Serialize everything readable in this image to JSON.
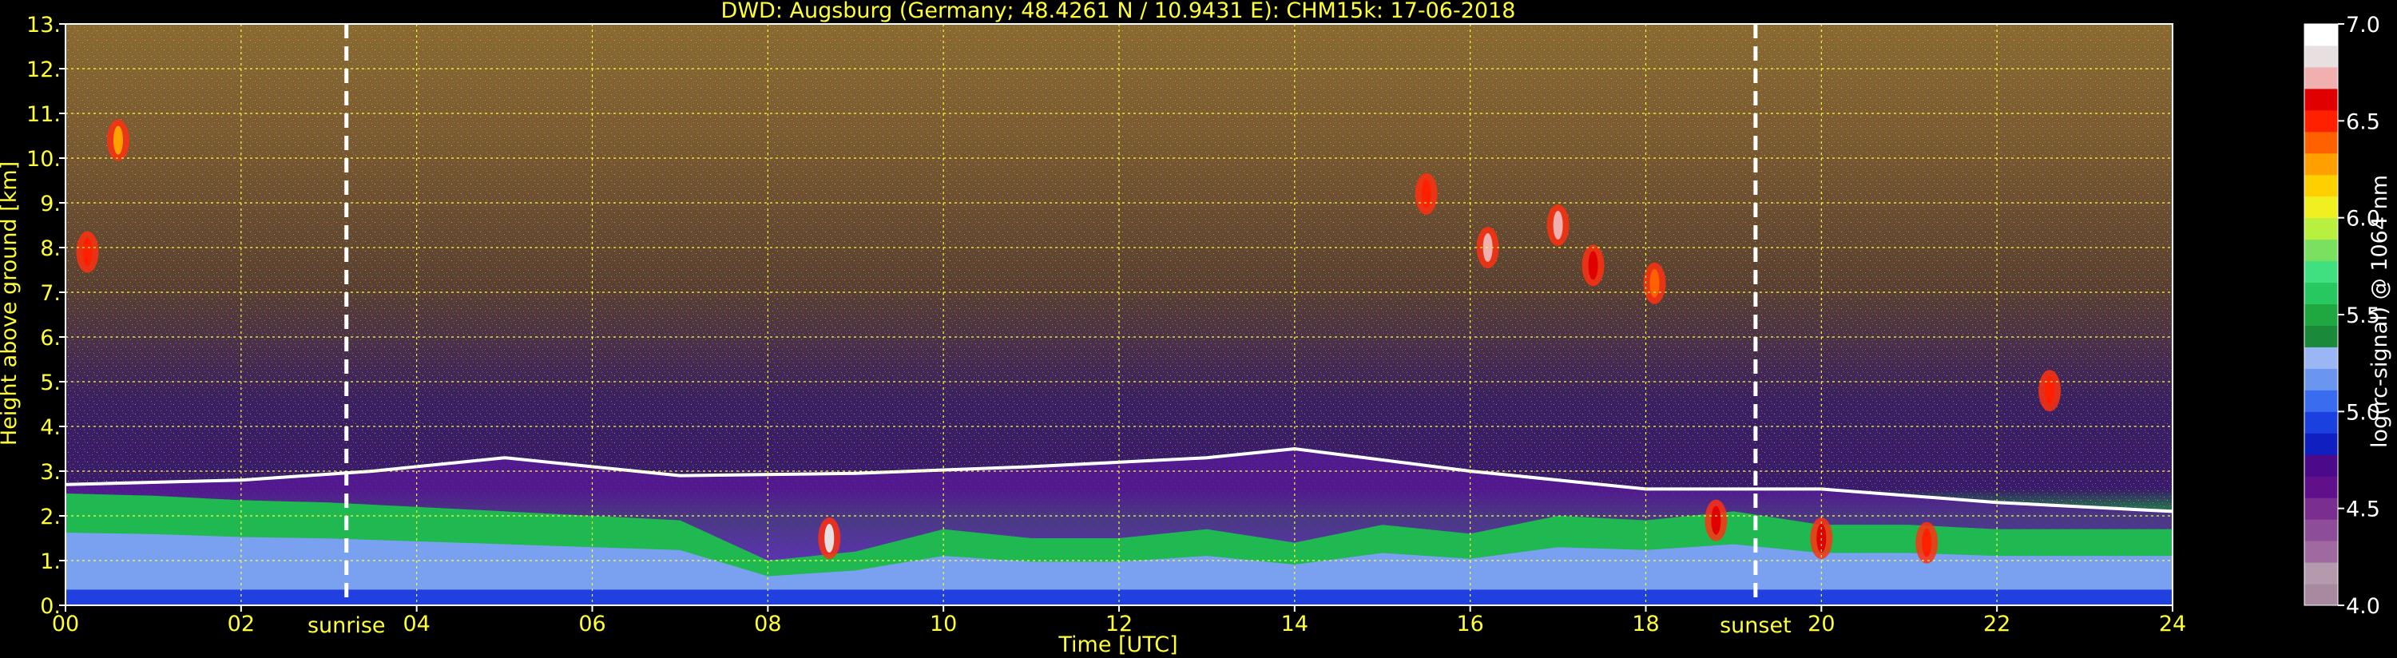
{
  "chart_data": {
    "type": "heatmap",
    "title": "DWD: Augsburg (Germany; 48.4261 N / 10.9431 E):    CHM15k: 17-06-2018",
    "xlabel": "Time [UTC]",
    "ylabel": "Height above ground [km]",
    "xlim": [
      0,
      24
    ],
    "ylim": [
      0,
      13
    ],
    "x_ticks": [
      "00",
      "02",
      "04",
      "06",
      "08",
      "10",
      "12",
      "14",
      "16",
      "18",
      "20",
      "22",
      "24"
    ],
    "y_ticks": [
      "0.",
      "1.",
      "2.",
      "3.",
      "4.",
      "5.",
      "6.",
      "7.",
      "8.",
      "9.",
      "10.",
      "11.",
      "12.",
      "13."
    ],
    "grid": true,
    "events": [
      {
        "label": "sunrise",
        "time": 3.2
      },
      {
        "label": "sunset",
        "time": 19.25
      }
    ],
    "colorbar": {
      "label": "log(rc-signal) @ 1064 nm",
      "range": [
        4.0,
        7.0
      ],
      "ticks": [
        "4.0",
        "4.5",
        "5.0",
        "5.5",
        "6.0",
        "6.5",
        "7.0"
      ],
      "colors": [
        "#a88aa0",
        "#b59aad",
        "#9e6aa0",
        "#8e4d98",
        "#7a2e90",
        "#60108a",
        "#4a0a8a",
        "#1020c0",
        "#1a40e0",
        "#3a6cf0",
        "#6a96f0",
        "#9ab6f5",
        "#1a8a3a",
        "#20a840",
        "#28c860",
        "#40e080",
        "#7ae060",
        "#b8f040",
        "#f0f020",
        "#ffd000",
        "#ffa000",
        "#ff6000",
        "#ff2000",
        "#e00000",
        "#f0b0b0",
        "#e8e0e0",
        "#ffffff"
      ]
    },
    "boundary_layer_top_km": [
      {
        "time": 0,
        "height": 2.5
      },
      {
        "time": 1,
        "height": 2.45
      },
      {
        "time": 2,
        "height": 2.35
      },
      {
        "time": 3,
        "height": 2.3
      },
      {
        "time": 4,
        "height": 2.2
      },
      {
        "time": 5,
        "height": 2.1
      },
      {
        "time": 6,
        "height": 2.0
      },
      {
        "time": 7,
        "height": 1.9
      },
      {
        "time": 8,
        "height": 1.0
      },
      {
        "time": 9,
        "height": 1.2
      },
      {
        "time": 10,
        "height": 1.7
      },
      {
        "time": 11,
        "height": 1.5
      },
      {
        "time": 12,
        "height": 1.5
      },
      {
        "time": 13,
        "height": 1.7
      },
      {
        "time": 14,
        "height": 1.4
      },
      {
        "time": 15,
        "height": 1.8
      },
      {
        "time": 16,
        "height": 1.6
      },
      {
        "time": 17,
        "height": 2.0
      },
      {
        "time": 18,
        "height": 1.9
      },
      {
        "time": 19,
        "height": 2.1
      },
      {
        "time": 20,
        "height": 1.8
      },
      {
        "time": 21,
        "height": 1.8
      },
      {
        "time": 22,
        "height": 1.7
      },
      {
        "time": 23,
        "height": 1.7
      },
      {
        "time": 24,
        "height": 1.7
      }
    ],
    "residual_layer_top_km": [
      {
        "time": 0,
        "height": 2.7
      },
      {
        "time": 2,
        "height": 2.8
      },
      {
        "time": 3.5,
        "height": 3.0
      },
      {
        "time": 5,
        "height": 3.3
      },
      {
        "time": 7,
        "height": 2.9
      },
      {
        "time": 9,
        "height": 2.95
      },
      {
        "time": 11,
        "height": 3.1
      },
      {
        "time": 13,
        "height": 3.3
      },
      {
        "time": 14,
        "height": 3.5
      },
      {
        "time": 16,
        "height": 3.0
      },
      {
        "time": 18,
        "height": 2.6
      },
      {
        "time": 20,
        "height": 2.6
      },
      {
        "time": 22,
        "height": 2.3
      },
      {
        "time": 24,
        "height": 2.1
      }
    ],
    "cloud_features": [
      {
        "time": 0.6,
        "height": 10.4,
        "level": 6.3
      },
      {
        "time": 0.25,
        "height": 7.9,
        "level": 6.5
      },
      {
        "time": 15.5,
        "height": 9.2,
        "level": 6.5
      },
      {
        "time": 16.2,
        "height": 8.0,
        "level": 6.8
      },
      {
        "time": 17.0,
        "height": 8.5,
        "level": 6.8
      },
      {
        "time": 17.4,
        "height": 7.6,
        "level": 6.6
      },
      {
        "time": 18.1,
        "height": 7.2,
        "level": 6.4
      },
      {
        "time": 22.6,
        "height": 4.8,
        "level": 6.5
      },
      {
        "time": 8.7,
        "height": 1.5,
        "level": 6.9
      },
      {
        "time": 18.8,
        "height": 1.9,
        "level": 6.7
      },
      {
        "time": 20.0,
        "height": 1.5,
        "level": 6.7
      },
      {
        "time": 21.2,
        "height": 1.4,
        "level": 6.5
      }
    ]
  }
}
